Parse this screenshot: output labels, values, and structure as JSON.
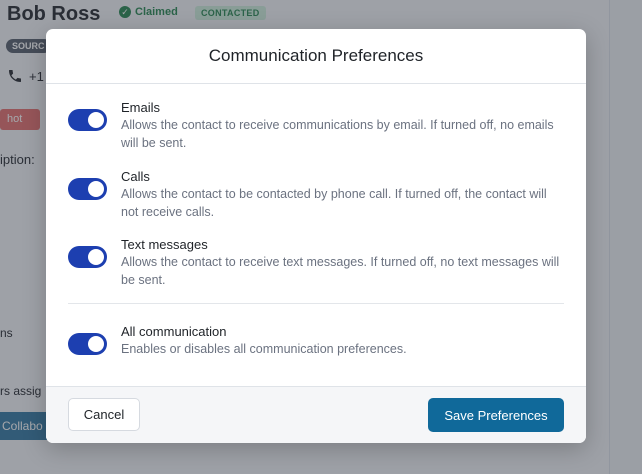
{
  "background": {
    "contact_name": "Bob Ross",
    "claimed_label": "Claimed",
    "contacted_badge": "CONTACTED",
    "source_badge": "SOURC",
    "phone_partial": "+1",
    "hot_tag": "hot",
    "description_partial": "iption:",
    "ns_partial": "ns",
    "assign_partial": "rs assig",
    "collab_partial": "Collabo"
  },
  "modal": {
    "title": "Communication Preferences",
    "preferences": [
      {
        "title": "Emails",
        "description": "Allows the contact to receive communications by email. If turned off, no emails will be sent.",
        "enabled": true
      },
      {
        "title": "Calls",
        "description": "Allows the contact to be contacted by phone call. If turned off, the contact will not receive calls.",
        "enabled": true
      },
      {
        "title": "Text messages",
        "description": "Allows the contact to receive text messages. If turned off, no text messages will be sent.",
        "enabled": true
      }
    ],
    "all_communication": {
      "title": "All communication",
      "description": "Enables or disables all communication preferences.",
      "enabled": true
    },
    "cancel_label": "Cancel",
    "save_label": "Save Preferences"
  },
  "colors": {
    "toggle_on": "#1d3fb0",
    "save_button": "#10699a",
    "claimed_green": "#2e8b57",
    "hot_tag": "#e57373"
  },
  "icons": [
    "check-icon",
    "phone-icon"
  ]
}
